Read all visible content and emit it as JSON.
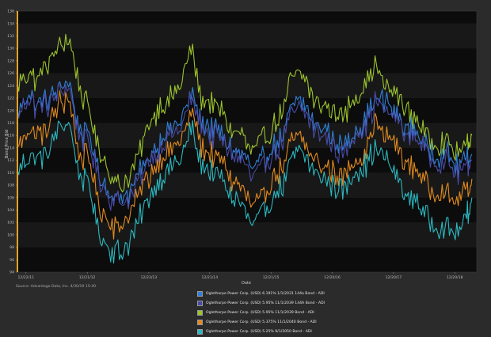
{
  "source": "Source: Advantage Data, Inc. 4/30/19 15:40",
  "colors": {
    "background": "#2b2b2b",
    "plot_band_dark": "#0c0c0c",
    "plot_band_light": "#181818",
    "axis_accent": "#e5a224"
  },
  "chart_data": {
    "type": "line",
    "title": "",
    "xlabel": "Date",
    "ylabel": "Bond Price Bid",
    "ylim": [
      94,
      136
    ],
    "yticks": [
      94,
      96,
      98,
      100,
      102,
      104,
      106,
      108,
      110,
      112,
      114,
      116,
      118,
      120,
      122,
      124,
      126,
      128,
      130,
      132,
      134,
      136
    ],
    "xlim": [
      "2011-11-01",
      "2019-04-30"
    ],
    "xticks": [
      {
        "date": "2011-12-22",
        "label": "12/22/11"
      },
      {
        "date": "2012-12-21",
        "label": "12/21/12"
      },
      {
        "date": "2013-12-23",
        "label": "12/23/13"
      },
      {
        "date": "2014-12-21",
        "label": "12/21/14"
      },
      {
        "date": "2015-12-21",
        "label": "12/21/15"
      },
      {
        "date": "2016-12-20",
        "label": "12/20/16"
      },
      {
        "date": "2017-12-20",
        "label": "12/20/17"
      },
      {
        "date": "2018-12-20",
        "label": "12/20/18"
      }
    ],
    "grid": false,
    "legend_position": "bottom-center",
    "x": [
      "2011-11",
      "2012-01",
      "2012-03",
      "2012-05",
      "2012-07",
      "2012-09",
      "2012-11",
      "2013-01",
      "2013-03",
      "2013-05",
      "2013-07",
      "2013-09",
      "2013-11",
      "2014-01",
      "2014-03",
      "2014-05",
      "2014-07",
      "2014-09",
      "2014-11",
      "2015-01",
      "2015-03",
      "2015-05",
      "2015-07",
      "2015-09",
      "2015-11",
      "2016-01",
      "2016-03",
      "2016-05",
      "2016-07",
      "2016-09",
      "2016-11",
      "2017-01",
      "2017-03",
      "2017-05",
      "2017-07",
      "2017-09",
      "2017-11",
      "2018-01",
      "2018-03",
      "2018-05",
      "2018-07",
      "2018-09",
      "2018-11",
      "2019-01",
      "2019-03",
      "2019-04"
    ],
    "series": [
      {
        "name": "Oglethorpe Power Corp. (USD) 6.191% 1/1/2031 144a Bond - ADI",
        "color": "#2f7fd6",
        "values": [
          120,
          123,
          121,
          122,
          124,
          125,
          117,
          116,
          110,
          107,
          106,
          107,
          110,
          113,
          115,
          117,
          118,
          123,
          118,
          117,
          116,
          114,
          113,
          110,
          112,
          114,
          116,
          121,
          121,
          118,
          117,
          115,
          114,
          117,
          118,
          122,
          121,
          120,
          117,
          117,
          114,
          113,
          113,
          111,
          112,
          113
        ]
      },
      {
        "name": "Oglethorpe Power Corp. (USD) 5.95% 11/1/2039 144A Bond - ADI",
        "color": "#4a4aa6",
        "values": [
          119,
          122,
          120,
          121,
          123,
          124,
          116,
          115,
          109,
          106,
          105,
          106,
          109,
          112,
          114,
          116,
          117,
          122,
          117,
          116,
          115,
          113,
          112,
          109,
          111,
          113,
          115,
          120,
          120,
          117,
          116,
          114,
          113,
          116,
          117,
          121,
          120,
          119,
          116,
          116,
          113,
          112,
          112,
          110,
          111,
          112
        ]
      },
      {
        "name": "Oglethorpe Power Corp. (USD) 5.95% 11/1/2039 Bond - ADI",
        "color": "#9cc42c",
        "values": [
          124,
          126,
          125,
          128,
          130,
          132,
          124,
          120,
          114,
          110,
          108,
          109,
          114,
          118,
          121,
          122,
          124,
          130,
          122,
          121,
          120,
          117,
          116,
          113,
          115,
          117,
          120,
          126,
          126,
          122,
          121,
          120,
          119,
          122,
          124,
          127,
          124,
          123,
          120,
          119,
          116,
          115,
          115,
          113,
          114,
          116
        ]
      },
      {
        "name": "Oglethorpe Power Corp. (USD) 5.375% 11/1/2040 Bond - ADI",
        "color": "#e08a1e",
        "values": [
          114,
          117,
          116,
          117,
          121,
          122,
          113,
          112,
          105,
          102,
          101,
          103,
          107,
          110,
          112,
          114,
          115,
          120,
          114,
          113,
          112,
          109,
          108,
          104,
          106,
          109,
          111,
          116,
          115,
          112,
          111,
          110,
          109,
          112,
          113,
          118,
          116,
          115,
          111,
          111,
          108,
          107,
          107,
          105,
          107,
          109
        ]
      },
      {
        "name": "Oglethorpe Power Corp. (USD) 5.25% 9/1/2050 Bond - ADI",
        "color": "#2bb8c0",
        "values": [
          110,
          113,
          112,
          113,
          117,
          118,
          110,
          108,
          101,
          98,
          97,
          99,
          103,
          107,
          109,
          111,
          112,
          117,
          111,
          110,
          109,
          106,
          105,
          101,
          103,
          106,
          108,
          113,
          113,
          110,
          109,
          108,
          107,
          110,
          111,
          114,
          112,
          110,
          106,
          106,
          103,
          102,
          101,
          100,
          103,
          106
        ]
      }
    ]
  }
}
